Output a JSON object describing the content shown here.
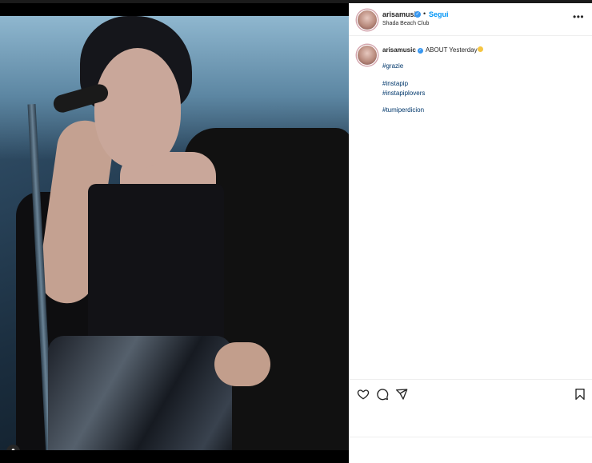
{
  "post": {
    "username": "arisamusic",
    "follow_label": "Segui",
    "location": "Shada Beach Club",
    "more_label": "•••",
    "caption": {
      "username": "arisamusic",
      "text": "ABOUT Yesterday",
      "hashtags": [
        "#grazie",
        "#instapip",
        "#instapiplovers",
        "#tumiperdicion"
      ]
    }
  },
  "icons": {
    "verified": "verified-badge-icon",
    "more": "more-options-icon",
    "like": "heart-icon",
    "comment": "comment-icon",
    "share": "send-icon",
    "save": "bookmark-icon",
    "tag": "user-tag-icon"
  },
  "colors": {
    "accent": "#0095f6",
    "verified": "#3897f0",
    "hashtag": "#00376b",
    "text": "#262626"
  }
}
